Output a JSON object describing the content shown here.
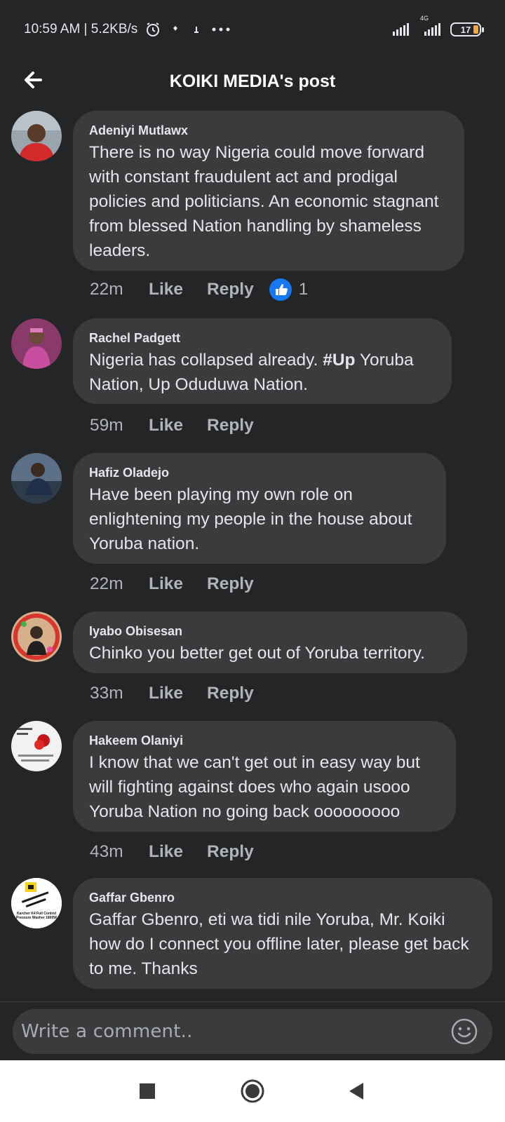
{
  "status_bar": {
    "time": "10:59 AM | 5.2KB/s",
    "network_label": "4G",
    "battery": "17",
    "icons": [
      "alarm-icon",
      "notification-icon",
      "notification-icon",
      "more-icon",
      "signal-icon",
      "signal-icon",
      "battery-icon"
    ]
  },
  "header": {
    "title": "KOIKI MEDIA's post",
    "back_icon": "arrow-left-icon"
  },
  "comments": [
    {
      "author": "Adeniyi Mutlawx",
      "text": "There is no way Nigeria could move forward with constant fraudulent act and prodigal policies and politicians. An economic stagnant from blessed Nation handling by shameless leaders.",
      "time": "22m",
      "like_label": "Like",
      "reply_label": "Reply",
      "reaction_count": "1"
    },
    {
      "author": "Rachel Padgett",
      "text_before": "Nigeria has collapsed already. ",
      "hashtag": "#Up",
      "text_after": " Yoruba Nation, Up Oduduwa Nation.",
      "time": "59m",
      "like_label": "Like",
      "reply_label": "Reply"
    },
    {
      "author": "Hafiz Oladejo",
      "text": "Have been playing my own role on enlightening my people in the house about Yoruba nation.",
      "time": "22m",
      "like_label": "Like",
      "reply_label": "Reply"
    },
    {
      "author": "Iyabo Obisesan",
      "text": "Chinko you better get out of Yoruba territory.",
      "time": "33m",
      "like_label": "Like",
      "reply_label": "Reply"
    },
    {
      "author": "Hakeem Olaniyi",
      "text": "I know that we can't get out in easy way but will fighting against does who again usooo Yoruba Nation no going back ooooooooo",
      "time": "43m",
      "like_label": "Like",
      "reply_label": "Reply"
    },
    {
      "author": "Gaffar Gbenro",
      "text": "Gaffar Gbenro, eti wa tidi nile Yoruba, Mr. Koiki how do I connect you offline later, please get back to me. Thanks",
      "avatar_caption": "Karcher K4 Full Control Pressure Washer 1800W"
    }
  ],
  "composer": {
    "placeholder": "Write a comment..",
    "emoji_icon": "smiley-icon"
  },
  "nav_bar": {
    "icons": [
      "recent-apps-icon",
      "home-icon",
      "back-icon"
    ]
  }
}
